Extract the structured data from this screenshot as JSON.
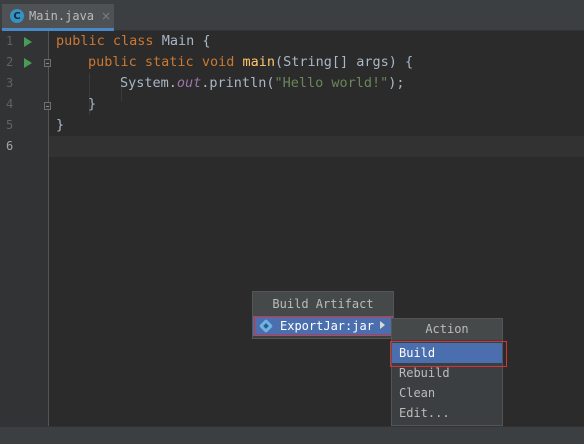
{
  "tab": {
    "label": "Main.java",
    "icon": "java-class-icon",
    "close": "×"
  },
  "gutter": {
    "line_numbers": [
      "1",
      "2",
      "3",
      "4",
      "5",
      "6"
    ],
    "current_line": "6"
  },
  "code": {
    "line1": {
      "kw1": "public",
      "kw2": "class",
      "name": "Main",
      "brace": "{"
    },
    "line2": {
      "kw1": "public",
      "kw2": "static",
      "kw3": "void",
      "fn": "main",
      "params": "(String[] args) {"
    },
    "line3": {
      "obj": "System.",
      "field": "out",
      "call": ".println(",
      "str": "\"Hello world!\"",
      "end": ");"
    },
    "line4": {
      "brace": "}"
    },
    "line5": {
      "brace": "}"
    }
  },
  "popup_build_artifact": {
    "title": "Build Artifact",
    "item": "ExportJar:jar"
  },
  "popup_action": {
    "title": "Action",
    "items": [
      "Build",
      "Rebuild",
      "Clean",
      "Edit..."
    ],
    "selected": "Build"
  },
  "colors": {
    "accent": "#4b6eaf",
    "highlight_border": "#d0353a",
    "background": "#2b2b2b"
  }
}
